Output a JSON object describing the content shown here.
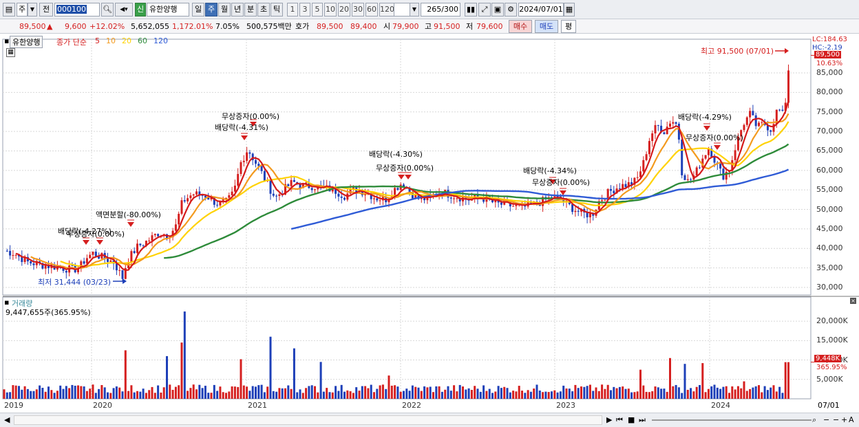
{
  "toolbar": {
    "period_mode": "주",
    "all_label": "전",
    "stock_code": "000100",
    "new_badge": "신",
    "stock_name": "유한양행",
    "intervals": [
      "일",
      "주",
      "월",
      "년",
      "분",
      "초",
      "틱"
    ],
    "active_interval": "주",
    "tick_nums": [
      "1",
      "3",
      "5",
      "10",
      "20",
      "30",
      "60",
      "120"
    ],
    "count": "265",
    "count_total": "/300",
    "date": "2024/07/01"
  },
  "quote": {
    "price": "89,500",
    "change": "9,600",
    "change_pct": "+12.02%",
    "volume": "5,652,055",
    "volume_pct": "1,172.01%",
    "turnover": "7.05%",
    "amount": "500,575백만",
    "ask_label": "호가",
    "ask": "89,500",
    "bid": "89,400",
    "open_label": "시",
    "open": "79,900",
    "high_label": "고",
    "high": "91,500",
    "low_label": "저",
    "low": "79,600",
    "buy_label": "매수",
    "sell_label": "매도",
    "even_label": "평"
  },
  "price_panel": {
    "stock_tag": "유한양행",
    "ma_title": "종가 단순",
    "ma_periods": [
      "5",
      "10",
      "20",
      "60",
      "120"
    ],
    "ma_colors": [
      "#d41a1a",
      "#f39a1e",
      "#ffd200",
      "#2e8b3a",
      "#2f5bd6"
    ],
    "lc": "LC:184.63",
    "hc": "HC:-2.19",
    "price_tag": "89,500",
    "pct_tag": "10.63%",
    "high_note": "최고 91,500 (07/01)",
    "low_note": "최저 31,444 (03/23)",
    "y_ticks": [
      "85,000",
      "80,000",
      "75,000",
      "70,000",
      "65,000",
      "60,000",
      "55,000",
      "50,000",
      "45,000",
      "40,000",
      "35,000",
      "30,000"
    ],
    "annotations": [
      {
        "text": "배당락(-4.27%)"
      },
      {
        "text": "무상증자(0.00%)"
      },
      {
        "text": "액면분할(-80.00%)"
      },
      {
        "text": "무상증자(0.00%)"
      },
      {
        "text": "배당락(-4.31%)"
      },
      {
        "text": "배당락(-4.30%)"
      },
      {
        "text": "무상증자(0.00%)"
      },
      {
        "text": "배당락(-4.34%)"
      },
      {
        "text": "무상증자(0.00%)"
      },
      {
        "text": "배당락(-4.29%)"
      },
      {
        "text": "무상증자(0.00%)"
      }
    ]
  },
  "volume_panel": {
    "title": "거래량",
    "value": "9,447,655주(365.95%)",
    "y_ticks": [
      "20,000K",
      "15,000K",
      "10,000K",
      "5,000K"
    ],
    "vol_tag": "9,448K",
    "vol_pct_tag": "365.95%"
  },
  "x_axis": {
    "labels": [
      "2019",
      "2020",
      "2021",
      "2022",
      "2023",
      "2024"
    ],
    "date_tag": "07/01"
  },
  "colors": {
    "up": "#d51f1f",
    "down": "#1d3fb8",
    "ma5": "#d41a1a",
    "ma10": "#f39a1e",
    "ma20": "#ffd200",
    "ma60": "#2e8b3a",
    "ma120": "#2f5bd6"
  }
}
